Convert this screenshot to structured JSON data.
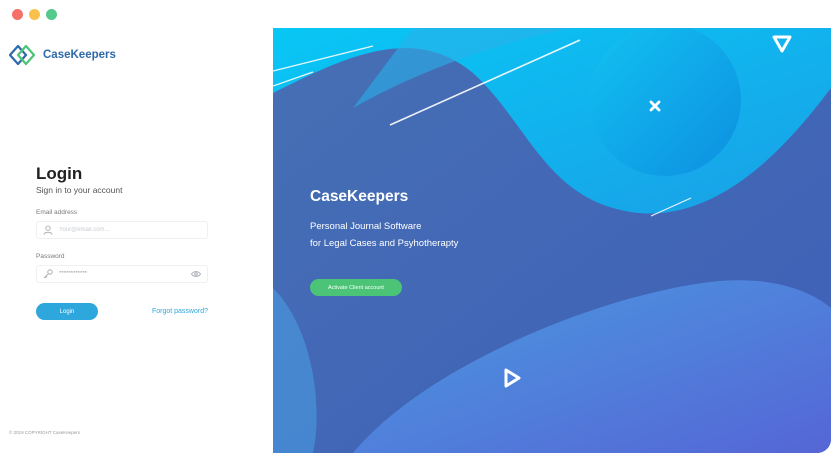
{
  "brand": {
    "name": "CaseKeepers"
  },
  "login": {
    "title": "Login",
    "subtitle": "Sign in to your account",
    "email_label": "Email address",
    "email_placeholder": "Your@email.com...",
    "email_value": "",
    "password_label": "Password",
    "password_value": "************",
    "login_button": "Login",
    "forgot_link": "Forgot password?"
  },
  "footer": {
    "copyright": "© 2019 COPYRIGHT CaseKeepers"
  },
  "hero": {
    "title": "CaseKeepers",
    "tagline_line1": "Personal Journal Software",
    "tagline_line2": "for Legal Cases and Psyhotherapty",
    "activate_button": "Activate Client account"
  },
  "colors": {
    "brand_blue": "#2e6aa9",
    "accent_blue": "#2ea7dd",
    "activate_green": "#4cc477",
    "hero_dark": "#3b6fb2",
    "hero_cyan": "#12bdf0"
  },
  "icons": [
    "diamond-logo-icon",
    "user-icon",
    "key-icon",
    "eye-icon",
    "triangle-icon",
    "x-icon",
    "play-icon"
  ]
}
